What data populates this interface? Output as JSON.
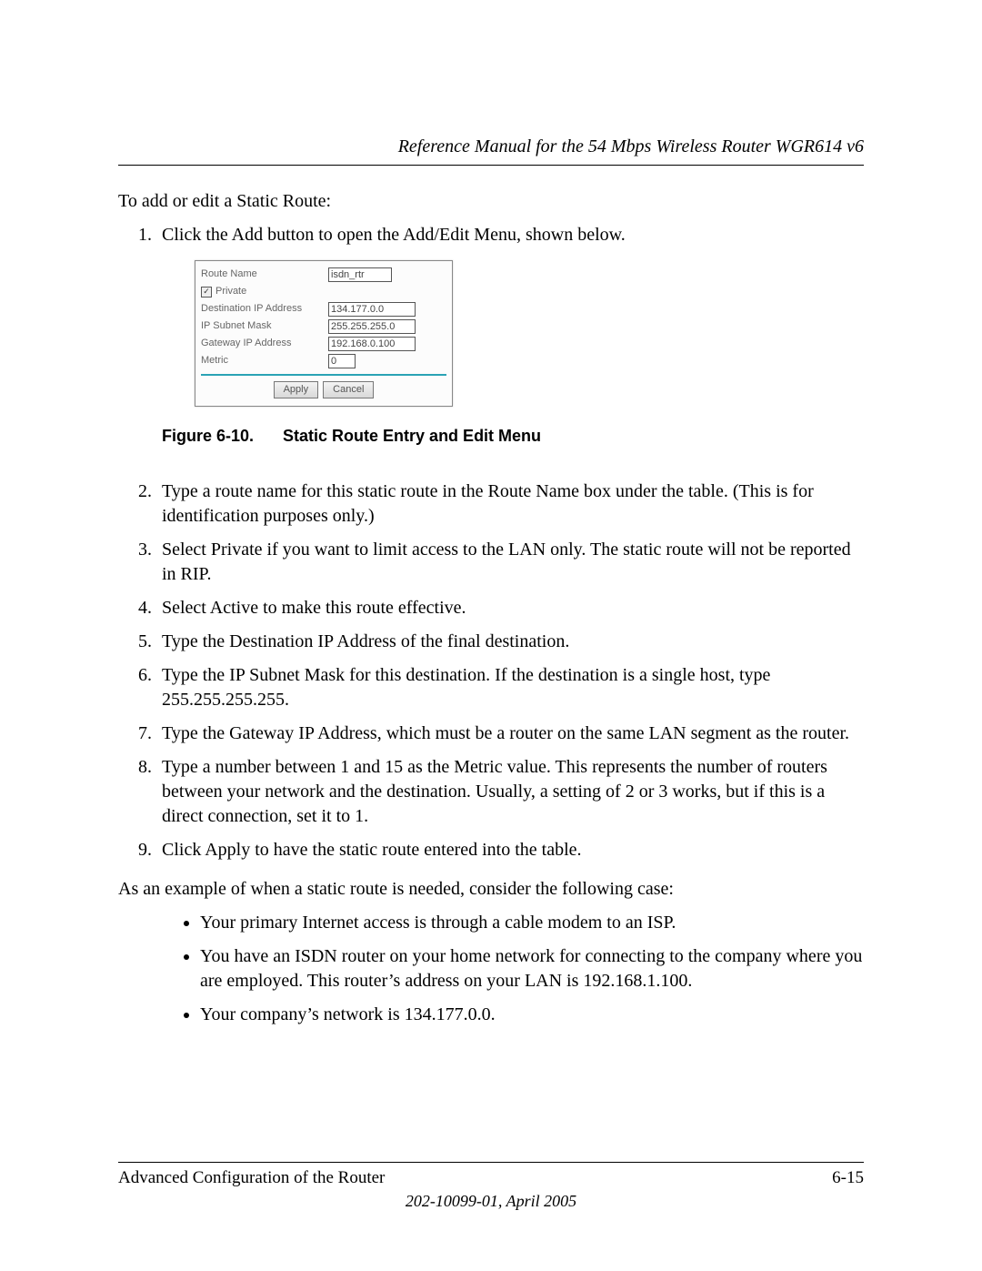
{
  "header": {
    "title": "Reference Manual for the 54 Mbps Wireless Router WGR614 v6"
  },
  "intro": "To add or edit a Static Route:",
  "step1": "Click the Add button to open the Add/Edit Menu, shown below.",
  "form": {
    "route_name_label": "Route Name",
    "route_name_value": "isdn_rtr",
    "private_label": "Private",
    "private_checked": "✓",
    "dest_label": "Destination IP Address",
    "dest_value": "134.177.0.0",
    "mask_label": "IP Subnet Mask",
    "mask_value": "255.255.255.0",
    "gw_label": "Gateway IP Address",
    "gw_value": "192.168.0.100",
    "metric_label": "Metric",
    "metric_value": "0",
    "apply": "Apply",
    "cancel": "Cancel"
  },
  "figure": {
    "number": "Figure 6-10.",
    "title": "Static Route Entry and Edit Menu"
  },
  "steps": {
    "s2": "Type a route name for this static route in the Route Name box under the table. (This is for identification purposes only.)",
    "s3": "Select Private if you want to limit access to the LAN only. The static route will not be reported in RIP.",
    "s4": "Select Active to make this route effective.",
    "s5": "Type the Destination IP Address of the final destination.",
    "s6": "Type the IP Subnet Mask for this destination. If the destination is a single host, type 255.255.255.255.",
    "s7": "Type the Gateway IP Address, which must be a router on the same LAN segment as the router.",
    "s8": "Type a number between 1 and 15 as the Metric value. This represents the number of routers between your network and the destination. Usually, a setting of 2 or 3 works, but if this is a direct connection, set it to 1.",
    "s9": "Click Apply to have the static route entered into the table."
  },
  "example_intro": "As an example of when a static route is needed, consider the following case:",
  "bullets": {
    "b1": "Your primary Internet access is through a cable modem to an ISP.",
    "b2": "You have an ISDN router on your home network for connecting to the company where you are employed. This router’s address on your LAN is 192.168.1.100.",
    "b3": "Your company’s network is 134.177.0.0."
  },
  "footer": {
    "section": "Advanced Configuration of the Router",
    "pagenum": "6-15",
    "pub": "202-10099-01, April 2005"
  }
}
